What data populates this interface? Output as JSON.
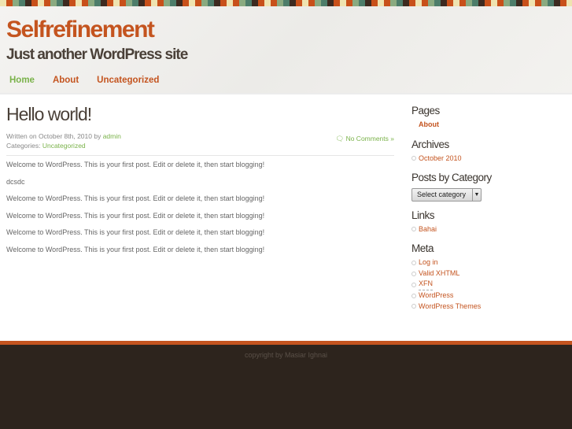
{
  "header": {
    "title": "Selfrefinement",
    "description": "Just another WordPress site"
  },
  "nav": [
    {
      "label": "Home"
    },
    {
      "label": "About"
    },
    {
      "label": "Uncategorized"
    }
  ],
  "post": {
    "title": "Hello world!",
    "written_prefix": "Written on October 8th, 2010 by ",
    "author": "admin",
    "categories_prefix": "Categories: ",
    "category": "Uncategorized",
    "comments": "No Comments »",
    "paragraphs": [
      "Welcome to WordPress. This is your first post. Edit or delete it, then start blogging!",
      "dcsdc",
      "Welcome to WordPress. This is your first post. Edit or delete it, then start blogging!",
      "Welcome to WordPress. This is your first post. Edit or delete it, then start blogging!",
      "Welcome to WordPress. This is your first post. Edit or delete it, then start blogging!",
      "Welcome to WordPress. This is your first post. Edit or delete it, then start blogging!"
    ]
  },
  "sidebar": {
    "pages_title": "Pages",
    "pages": [
      "About"
    ],
    "archives_title": "Archives",
    "archives": [
      "October 2010"
    ],
    "category_title": "Posts by Category",
    "category_select": "Select category",
    "links_title": "Links",
    "links": [
      "Bahai"
    ],
    "meta_title": "Meta",
    "meta": [
      "Log in",
      "Valid XHTML",
      "XFN",
      "WordPress",
      "WordPress Themes"
    ]
  },
  "footer": {
    "copyright": "copyright by Masiar Ighnai"
  },
  "colors": {
    "accent": "#c4541f",
    "green": "#7ab24a",
    "footer": "#2d241d"
  }
}
